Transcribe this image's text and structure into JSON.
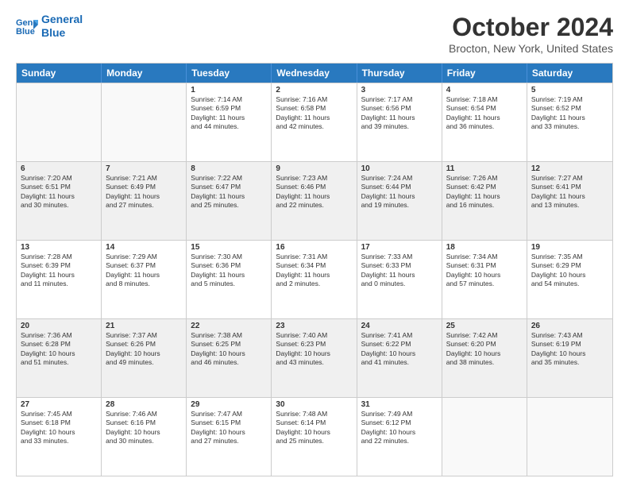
{
  "header": {
    "logo_line1": "General",
    "logo_line2": "Blue",
    "month": "October 2024",
    "location": "Brocton, New York, United States"
  },
  "days_of_week": [
    "Sunday",
    "Monday",
    "Tuesday",
    "Wednesday",
    "Thursday",
    "Friday",
    "Saturday"
  ],
  "weeks": [
    [
      {
        "day": "",
        "lines": [],
        "empty": true
      },
      {
        "day": "",
        "lines": [],
        "empty": true
      },
      {
        "day": "1",
        "lines": [
          "Sunrise: 7:14 AM",
          "Sunset: 6:59 PM",
          "Daylight: 11 hours",
          "and 44 minutes."
        ],
        "empty": false
      },
      {
        "day": "2",
        "lines": [
          "Sunrise: 7:16 AM",
          "Sunset: 6:58 PM",
          "Daylight: 11 hours",
          "and 42 minutes."
        ],
        "empty": false
      },
      {
        "day": "3",
        "lines": [
          "Sunrise: 7:17 AM",
          "Sunset: 6:56 PM",
          "Daylight: 11 hours",
          "and 39 minutes."
        ],
        "empty": false
      },
      {
        "day": "4",
        "lines": [
          "Sunrise: 7:18 AM",
          "Sunset: 6:54 PM",
          "Daylight: 11 hours",
          "and 36 minutes."
        ],
        "empty": false
      },
      {
        "day": "5",
        "lines": [
          "Sunrise: 7:19 AM",
          "Sunset: 6:52 PM",
          "Daylight: 11 hours",
          "and 33 minutes."
        ],
        "empty": false
      }
    ],
    [
      {
        "day": "6",
        "lines": [
          "Sunrise: 7:20 AM",
          "Sunset: 6:51 PM",
          "Daylight: 11 hours",
          "and 30 minutes."
        ],
        "empty": false
      },
      {
        "day": "7",
        "lines": [
          "Sunrise: 7:21 AM",
          "Sunset: 6:49 PM",
          "Daylight: 11 hours",
          "and 27 minutes."
        ],
        "empty": false
      },
      {
        "day": "8",
        "lines": [
          "Sunrise: 7:22 AM",
          "Sunset: 6:47 PM",
          "Daylight: 11 hours",
          "and 25 minutes."
        ],
        "empty": false
      },
      {
        "day": "9",
        "lines": [
          "Sunrise: 7:23 AM",
          "Sunset: 6:46 PM",
          "Daylight: 11 hours",
          "and 22 minutes."
        ],
        "empty": false
      },
      {
        "day": "10",
        "lines": [
          "Sunrise: 7:24 AM",
          "Sunset: 6:44 PM",
          "Daylight: 11 hours",
          "and 19 minutes."
        ],
        "empty": false
      },
      {
        "day": "11",
        "lines": [
          "Sunrise: 7:26 AM",
          "Sunset: 6:42 PM",
          "Daylight: 11 hours",
          "and 16 minutes."
        ],
        "empty": false
      },
      {
        "day": "12",
        "lines": [
          "Sunrise: 7:27 AM",
          "Sunset: 6:41 PM",
          "Daylight: 11 hours",
          "and 13 minutes."
        ],
        "empty": false
      }
    ],
    [
      {
        "day": "13",
        "lines": [
          "Sunrise: 7:28 AM",
          "Sunset: 6:39 PM",
          "Daylight: 11 hours",
          "and 11 minutes."
        ],
        "empty": false
      },
      {
        "day": "14",
        "lines": [
          "Sunrise: 7:29 AM",
          "Sunset: 6:37 PM",
          "Daylight: 11 hours",
          "and 8 minutes."
        ],
        "empty": false
      },
      {
        "day": "15",
        "lines": [
          "Sunrise: 7:30 AM",
          "Sunset: 6:36 PM",
          "Daylight: 11 hours",
          "and 5 minutes."
        ],
        "empty": false
      },
      {
        "day": "16",
        "lines": [
          "Sunrise: 7:31 AM",
          "Sunset: 6:34 PM",
          "Daylight: 11 hours",
          "and 2 minutes."
        ],
        "empty": false
      },
      {
        "day": "17",
        "lines": [
          "Sunrise: 7:33 AM",
          "Sunset: 6:33 PM",
          "Daylight: 11 hours",
          "and 0 minutes."
        ],
        "empty": false
      },
      {
        "day": "18",
        "lines": [
          "Sunrise: 7:34 AM",
          "Sunset: 6:31 PM",
          "Daylight: 10 hours",
          "and 57 minutes."
        ],
        "empty": false
      },
      {
        "day": "19",
        "lines": [
          "Sunrise: 7:35 AM",
          "Sunset: 6:29 PM",
          "Daylight: 10 hours",
          "and 54 minutes."
        ],
        "empty": false
      }
    ],
    [
      {
        "day": "20",
        "lines": [
          "Sunrise: 7:36 AM",
          "Sunset: 6:28 PM",
          "Daylight: 10 hours",
          "and 51 minutes."
        ],
        "empty": false
      },
      {
        "day": "21",
        "lines": [
          "Sunrise: 7:37 AM",
          "Sunset: 6:26 PM",
          "Daylight: 10 hours",
          "and 49 minutes."
        ],
        "empty": false
      },
      {
        "day": "22",
        "lines": [
          "Sunrise: 7:38 AM",
          "Sunset: 6:25 PM",
          "Daylight: 10 hours",
          "and 46 minutes."
        ],
        "empty": false
      },
      {
        "day": "23",
        "lines": [
          "Sunrise: 7:40 AM",
          "Sunset: 6:23 PM",
          "Daylight: 10 hours",
          "and 43 minutes."
        ],
        "empty": false
      },
      {
        "day": "24",
        "lines": [
          "Sunrise: 7:41 AM",
          "Sunset: 6:22 PM",
          "Daylight: 10 hours",
          "and 41 minutes."
        ],
        "empty": false
      },
      {
        "day": "25",
        "lines": [
          "Sunrise: 7:42 AM",
          "Sunset: 6:20 PM",
          "Daylight: 10 hours",
          "and 38 minutes."
        ],
        "empty": false
      },
      {
        "day": "26",
        "lines": [
          "Sunrise: 7:43 AM",
          "Sunset: 6:19 PM",
          "Daylight: 10 hours",
          "and 35 minutes."
        ],
        "empty": false
      }
    ],
    [
      {
        "day": "27",
        "lines": [
          "Sunrise: 7:45 AM",
          "Sunset: 6:18 PM",
          "Daylight: 10 hours",
          "and 33 minutes."
        ],
        "empty": false
      },
      {
        "day": "28",
        "lines": [
          "Sunrise: 7:46 AM",
          "Sunset: 6:16 PM",
          "Daylight: 10 hours",
          "and 30 minutes."
        ],
        "empty": false
      },
      {
        "day": "29",
        "lines": [
          "Sunrise: 7:47 AM",
          "Sunset: 6:15 PM",
          "Daylight: 10 hours",
          "and 27 minutes."
        ],
        "empty": false
      },
      {
        "day": "30",
        "lines": [
          "Sunrise: 7:48 AM",
          "Sunset: 6:14 PM",
          "Daylight: 10 hours",
          "and 25 minutes."
        ],
        "empty": false
      },
      {
        "day": "31",
        "lines": [
          "Sunrise: 7:49 AM",
          "Sunset: 6:12 PM",
          "Daylight: 10 hours",
          "and 22 minutes."
        ],
        "empty": false
      },
      {
        "day": "",
        "lines": [],
        "empty": true
      },
      {
        "day": "",
        "lines": [],
        "empty": true
      }
    ]
  ]
}
